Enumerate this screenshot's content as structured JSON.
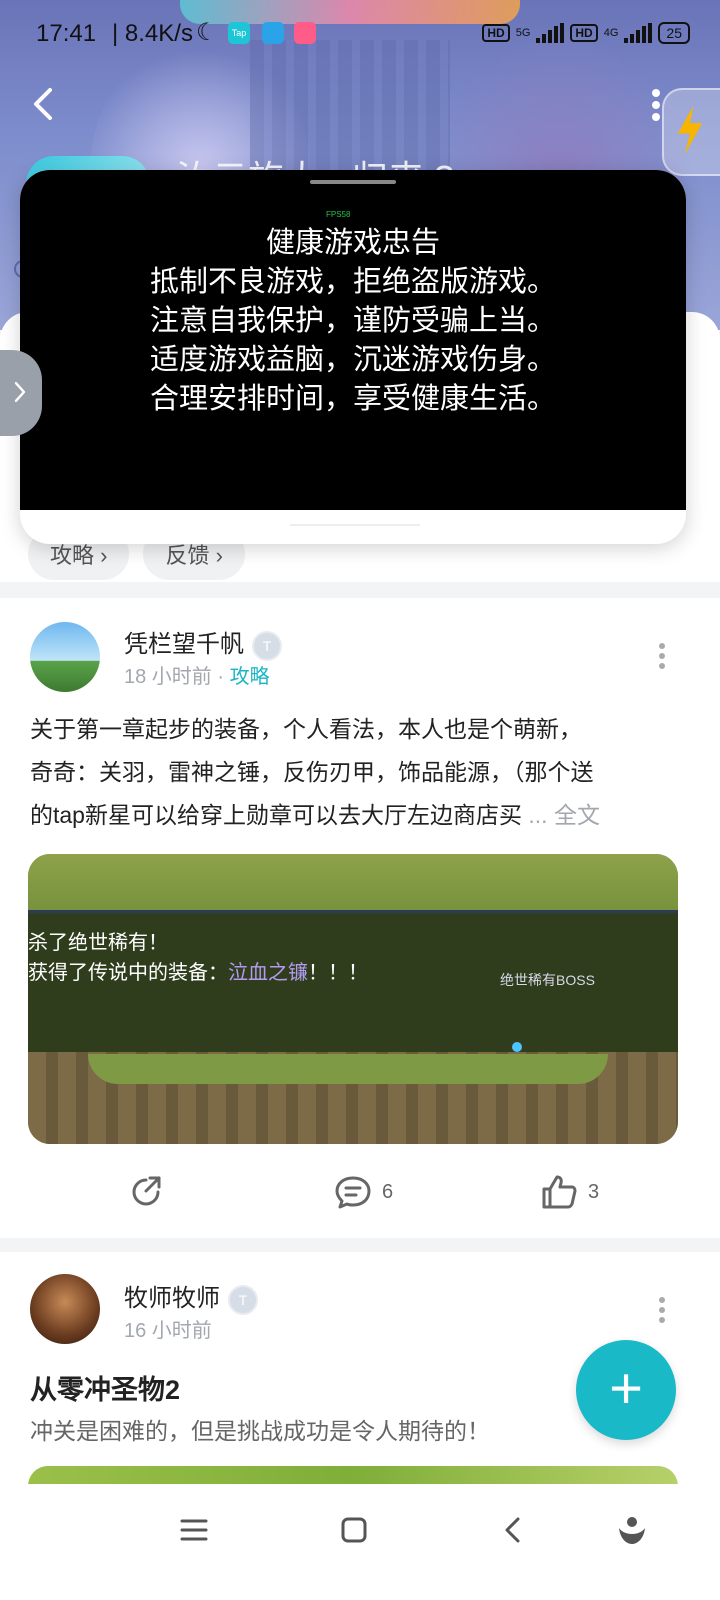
{
  "status_bar": {
    "time": "17:41",
    "network_speed": "| 8.4K/s",
    "tap_label": "Tap",
    "hd1": "HD",
    "net1": "5G",
    "hd2": "HD",
    "net2": "4G",
    "battery": "25"
  },
  "header": {
    "game_title_partial": "汝云旅大 · 归来 ?"
  },
  "overlay": {
    "fps_label": "FPS58",
    "notice_title": "健康游戏忠告",
    "notice_lines": [
      "抵制不良游戏，拒绝盗版游戏。",
      "注意自我保护，谨防受骗上当。",
      "适度游戏益脑，沉迷游戏伤身。",
      "合理安排时间，享受健康生活。"
    ]
  },
  "chips": [
    {
      "label": "攻略 ›"
    },
    {
      "label": "反馈 ›"
    }
  ],
  "posts": [
    {
      "author": "凭栏望千帆",
      "badge": "T",
      "time": "18 小时前",
      "separator": "·",
      "category": "攻略",
      "text_lines": [
        "关于第一章起步的装备，个人看法，本人也是个萌新，",
        "奇奇：关羽，雷神之锤，反伤刃甲，饰品能源，（那个送",
        "的tap新星可以给穿上勋章可以去大厅左边商店买"
      ],
      "ellipsis": " ... ",
      "full_text_label": "全文",
      "game_line1": "杀了绝世稀有！",
      "game_line2_prefix": "获得了传说中的装备：",
      "game_item": "泣血之镰",
      "game_line2_suffix": "！！！",
      "game_boss_label": "绝世稀有BOSS",
      "comments": "6",
      "likes": "3"
    },
    {
      "author": "牧师牧师",
      "badge": "T",
      "time": "16 小时前",
      "title": "从零冲圣物2",
      "subtitle": "冲关是困难的，但是挑战成功是令人期待的！"
    }
  ],
  "fab": {
    "label": "+"
  },
  "colors": {
    "accent": "#19b9c8",
    "category_link": "#19b5c6"
  }
}
